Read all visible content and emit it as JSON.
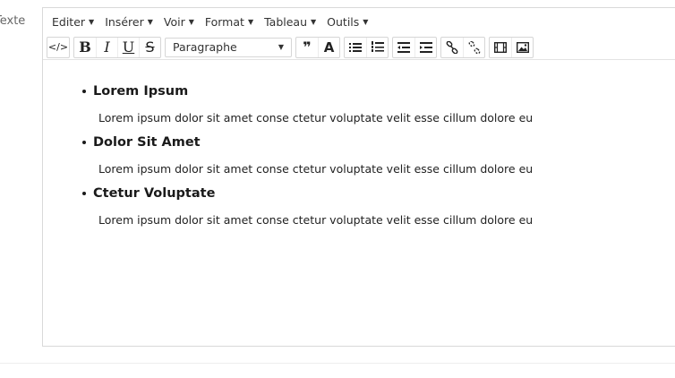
{
  "field": {
    "label": "Texte"
  },
  "menubar": {
    "items": [
      {
        "label": "Editer"
      },
      {
        "label": "Insérer"
      },
      {
        "label": "Voir"
      },
      {
        "label": "Format"
      },
      {
        "label": "Tableau"
      },
      {
        "label": "Outils"
      }
    ]
  },
  "toolbar": {
    "code_label": "</>",
    "bold_label": "B",
    "italic_label": "I",
    "underline_label": "U",
    "strike_label": "S",
    "format_select": "Paragraphe",
    "blockquote_label": "❞",
    "textcolor_label": "A",
    "icons": {
      "code": "source-code-icon",
      "bold": "bold-icon",
      "italic": "italic-icon",
      "underline": "underline-icon",
      "strike": "strikethrough-icon",
      "blockquote": "blockquote-icon",
      "textcolor": "text-color-icon",
      "bullist": "bullet-list-icon",
      "numlist": "numbered-list-icon",
      "outdent": "outdent-icon",
      "indent": "indent-icon",
      "link": "link-icon",
      "unlink": "unlink-icon",
      "media": "media-icon",
      "image": "image-icon"
    }
  },
  "content": {
    "items": [
      {
        "title": "Lorem Ipsum",
        "text": "Lorem ipsum dolor sit amet conse ctetur voluptate velit esse cillum dolore eu"
      },
      {
        "title": "Dolor Sit Amet",
        "text": "Lorem ipsum dolor sit amet conse ctetur voluptate velit esse cillum dolore eu"
      },
      {
        "title": "Ctetur Voluptate",
        "text": "Lorem ipsum dolor sit amet conse ctetur voluptate velit esse cillum dolore eu"
      }
    ]
  },
  "colors": {
    "border": "#d9d9d9",
    "text": "#222222",
    "label": "#666666"
  }
}
